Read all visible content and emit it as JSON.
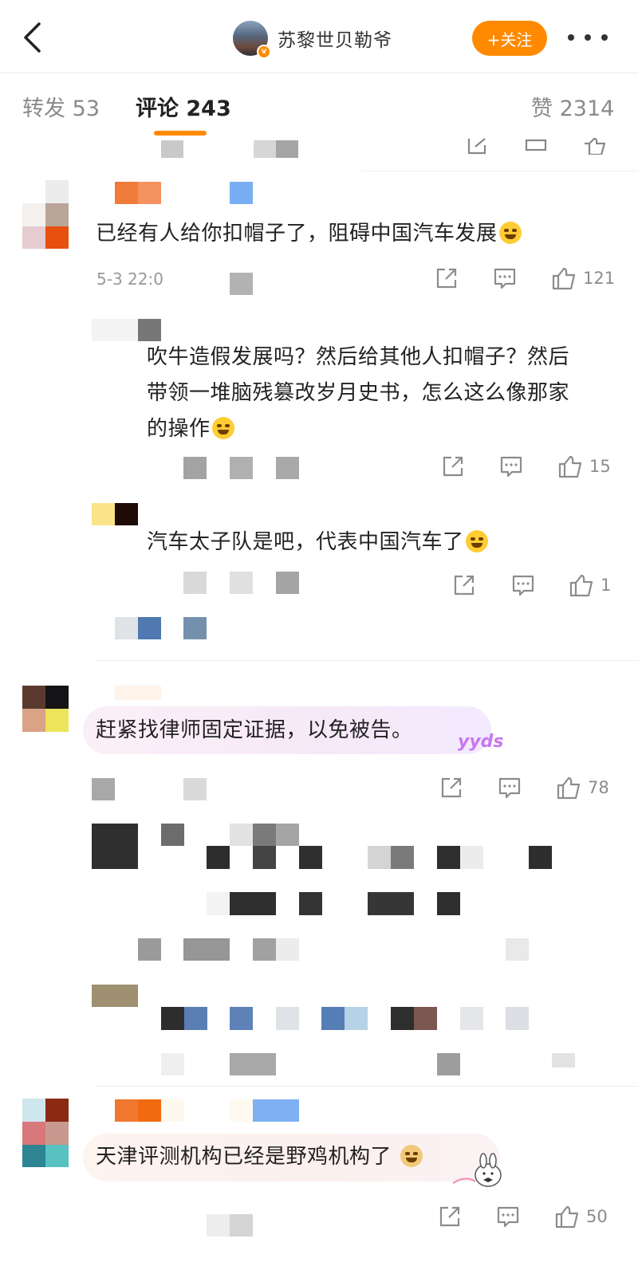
{
  "header": {
    "author_name": "苏黎世贝勒爷",
    "follow_label": "+关注"
  },
  "tabs": {
    "repost": "转发 53",
    "comments": "评论 243",
    "likes": "赞 2314"
  },
  "comments": [
    {
      "text": "已经有人给你扣帽子了，阻碍中国汽车发展",
      "date": "5-3 22:0",
      "likes": "121",
      "replies": [
        {
          "text_lines": [
            "吹牛造假发展吗？然后给其他人扣帽子？然后",
            "带领一堆脑残篡改岁月史书，怎么这么像那家",
            "的操作"
          ],
          "likes": "15"
        },
        {
          "text": "汽车太子队是吧，代表中国汽车了",
          "likes": "1"
        }
      ]
    },
    {
      "text": "赶紧找律师固定证据，以免被告。",
      "decoration": "yyds",
      "likes": "78"
    },
    {
      "text": "天津评测机构已经是野鸡机构了",
      "likes": "50"
    }
  ],
  "colors": {
    "accent": "#ff8a00",
    "text_primary": "#222222",
    "text_secondary": "#8a8a8a"
  },
  "icons": [
    "back-arrow-icon",
    "verified-badge-icon",
    "more-icon",
    "share-icon",
    "comment-icon",
    "like-icon"
  ]
}
